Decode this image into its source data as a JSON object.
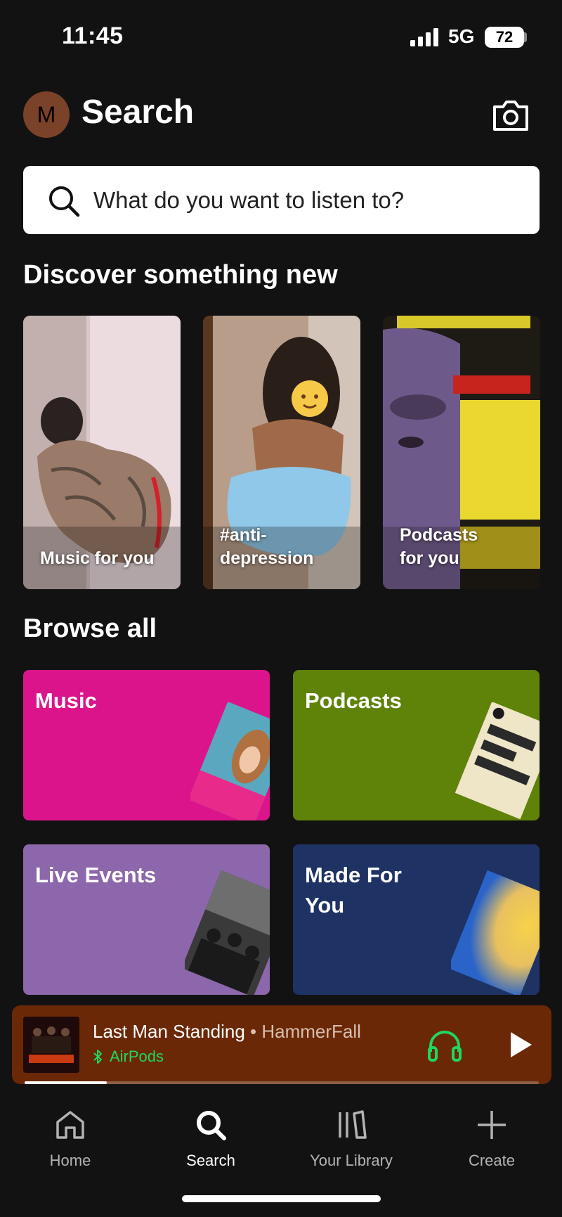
{
  "status_bar": {
    "time": "11:45",
    "network": "5G",
    "battery": "72"
  },
  "header": {
    "avatar_initial": "M",
    "title": "Search"
  },
  "search": {
    "placeholder": "What do you want to listen to?"
  },
  "discover": {
    "title": "Discover something new",
    "cards": [
      {
        "label": "Music for you"
      },
      {
        "label": "#anti-depression"
      },
      {
        "label": "Podcasts for you"
      }
    ]
  },
  "browse": {
    "title": "Browse all",
    "tiles": [
      {
        "label": "Music",
        "color": "#dc148c"
      },
      {
        "label": "Podcasts",
        "color": "#5f8209"
      },
      {
        "label": "Live Events",
        "color": "#8d67ab"
      },
      {
        "label": "Made For You",
        "color": "#1e3264"
      }
    ]
  },
  "now_playing": {
    "track": "Last Man Standing",
    "separator": " • ",
    "artist": "HammerFall",
    "device": "AirPods",
    "progress": 0.16
  },
  "tabs": [
    {
      "label": "Home",
      "icon": "home-icon",
      "active": false
    },
    {
      "label": "Search",
      "icon": "search-icon",
      "active": true
    },
    {
      "label": "Your Library",
      "icon": "library-icon",
      "active": false
    },
    {
      "label": "Create",
      "icon": "plus-icon",
      "active": false
    }
  ],
  "colors": {
    "accent": "#1ed760",
    "now_playing_bg": "#6a2806"
  }
}
